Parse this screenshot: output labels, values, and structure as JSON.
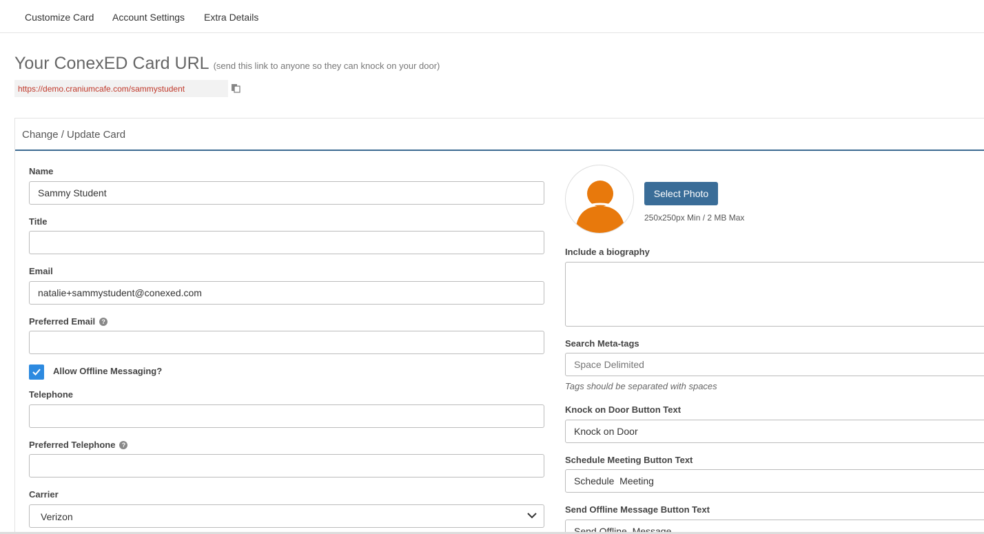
{
  "tabs": [
    "Customize Card",
    "Account Settings",
    "Extra Details"
  ],
  "url_section": {
    "title": "Your ConexED Card URL",
    "hint": "(send this link to anyone so they can knock on your door)",
    "url": "https://demo.craniumcafe.com/sammystudent"
  },
  "panel": {
    "title": "Change / Update Card"
  },
  "form": {
    "name_label": "Name",
    "name_value": "Sammy Student",
    "title_label": "Title",
    "title_value": "",
    "email_label": "Email",
    "email_value": "natalie+sammystudent@conexed.com",
    "preferred_email_label": "Preferred Email",
    "preferred_email_value": "",
    "offline_label": "Allow Offline Messaging?",
    "offline_checked": true,
    "telephone_label": "Telephone",
    "telephone_value": "",
    "preferred_telephone_label": "Preferred Telephone",
    "preferred_telephone_value": "",
    "carrier_label": "Carrier",
    "carrier_value": "Verizon"
  },
  "photo": {
    "button": "Select Photo",
    "hint": "250x250px Min / 2 MB Max"
  },
  "right": {
    "bio_label": "Include a biography",
    "bio_value": "",
    "meta_label": "Search Meta-tags",
    "meta_placeholder": "Space Delimited",
    "meta_hint": "Tags should be separated with spaces",
    "knock_label": "Knock on Door Button Text",
    "knock_value": "Knock on Door",
    "schedule_label": "Schedule Meeting Button Text",
    "schedule_value": "Schedule  Meeting",
    "offline_msg_label": "Send Offline Message Button Text",
    "offline_msg_value": "Send Offline  Message"
  },
  "colors": {
    "accent": "#3a6d98",
    "checkbox": "#2d8ae0",
    "avatar": "#e8790c",
    "url_text": "#c0392b"
  }
}
